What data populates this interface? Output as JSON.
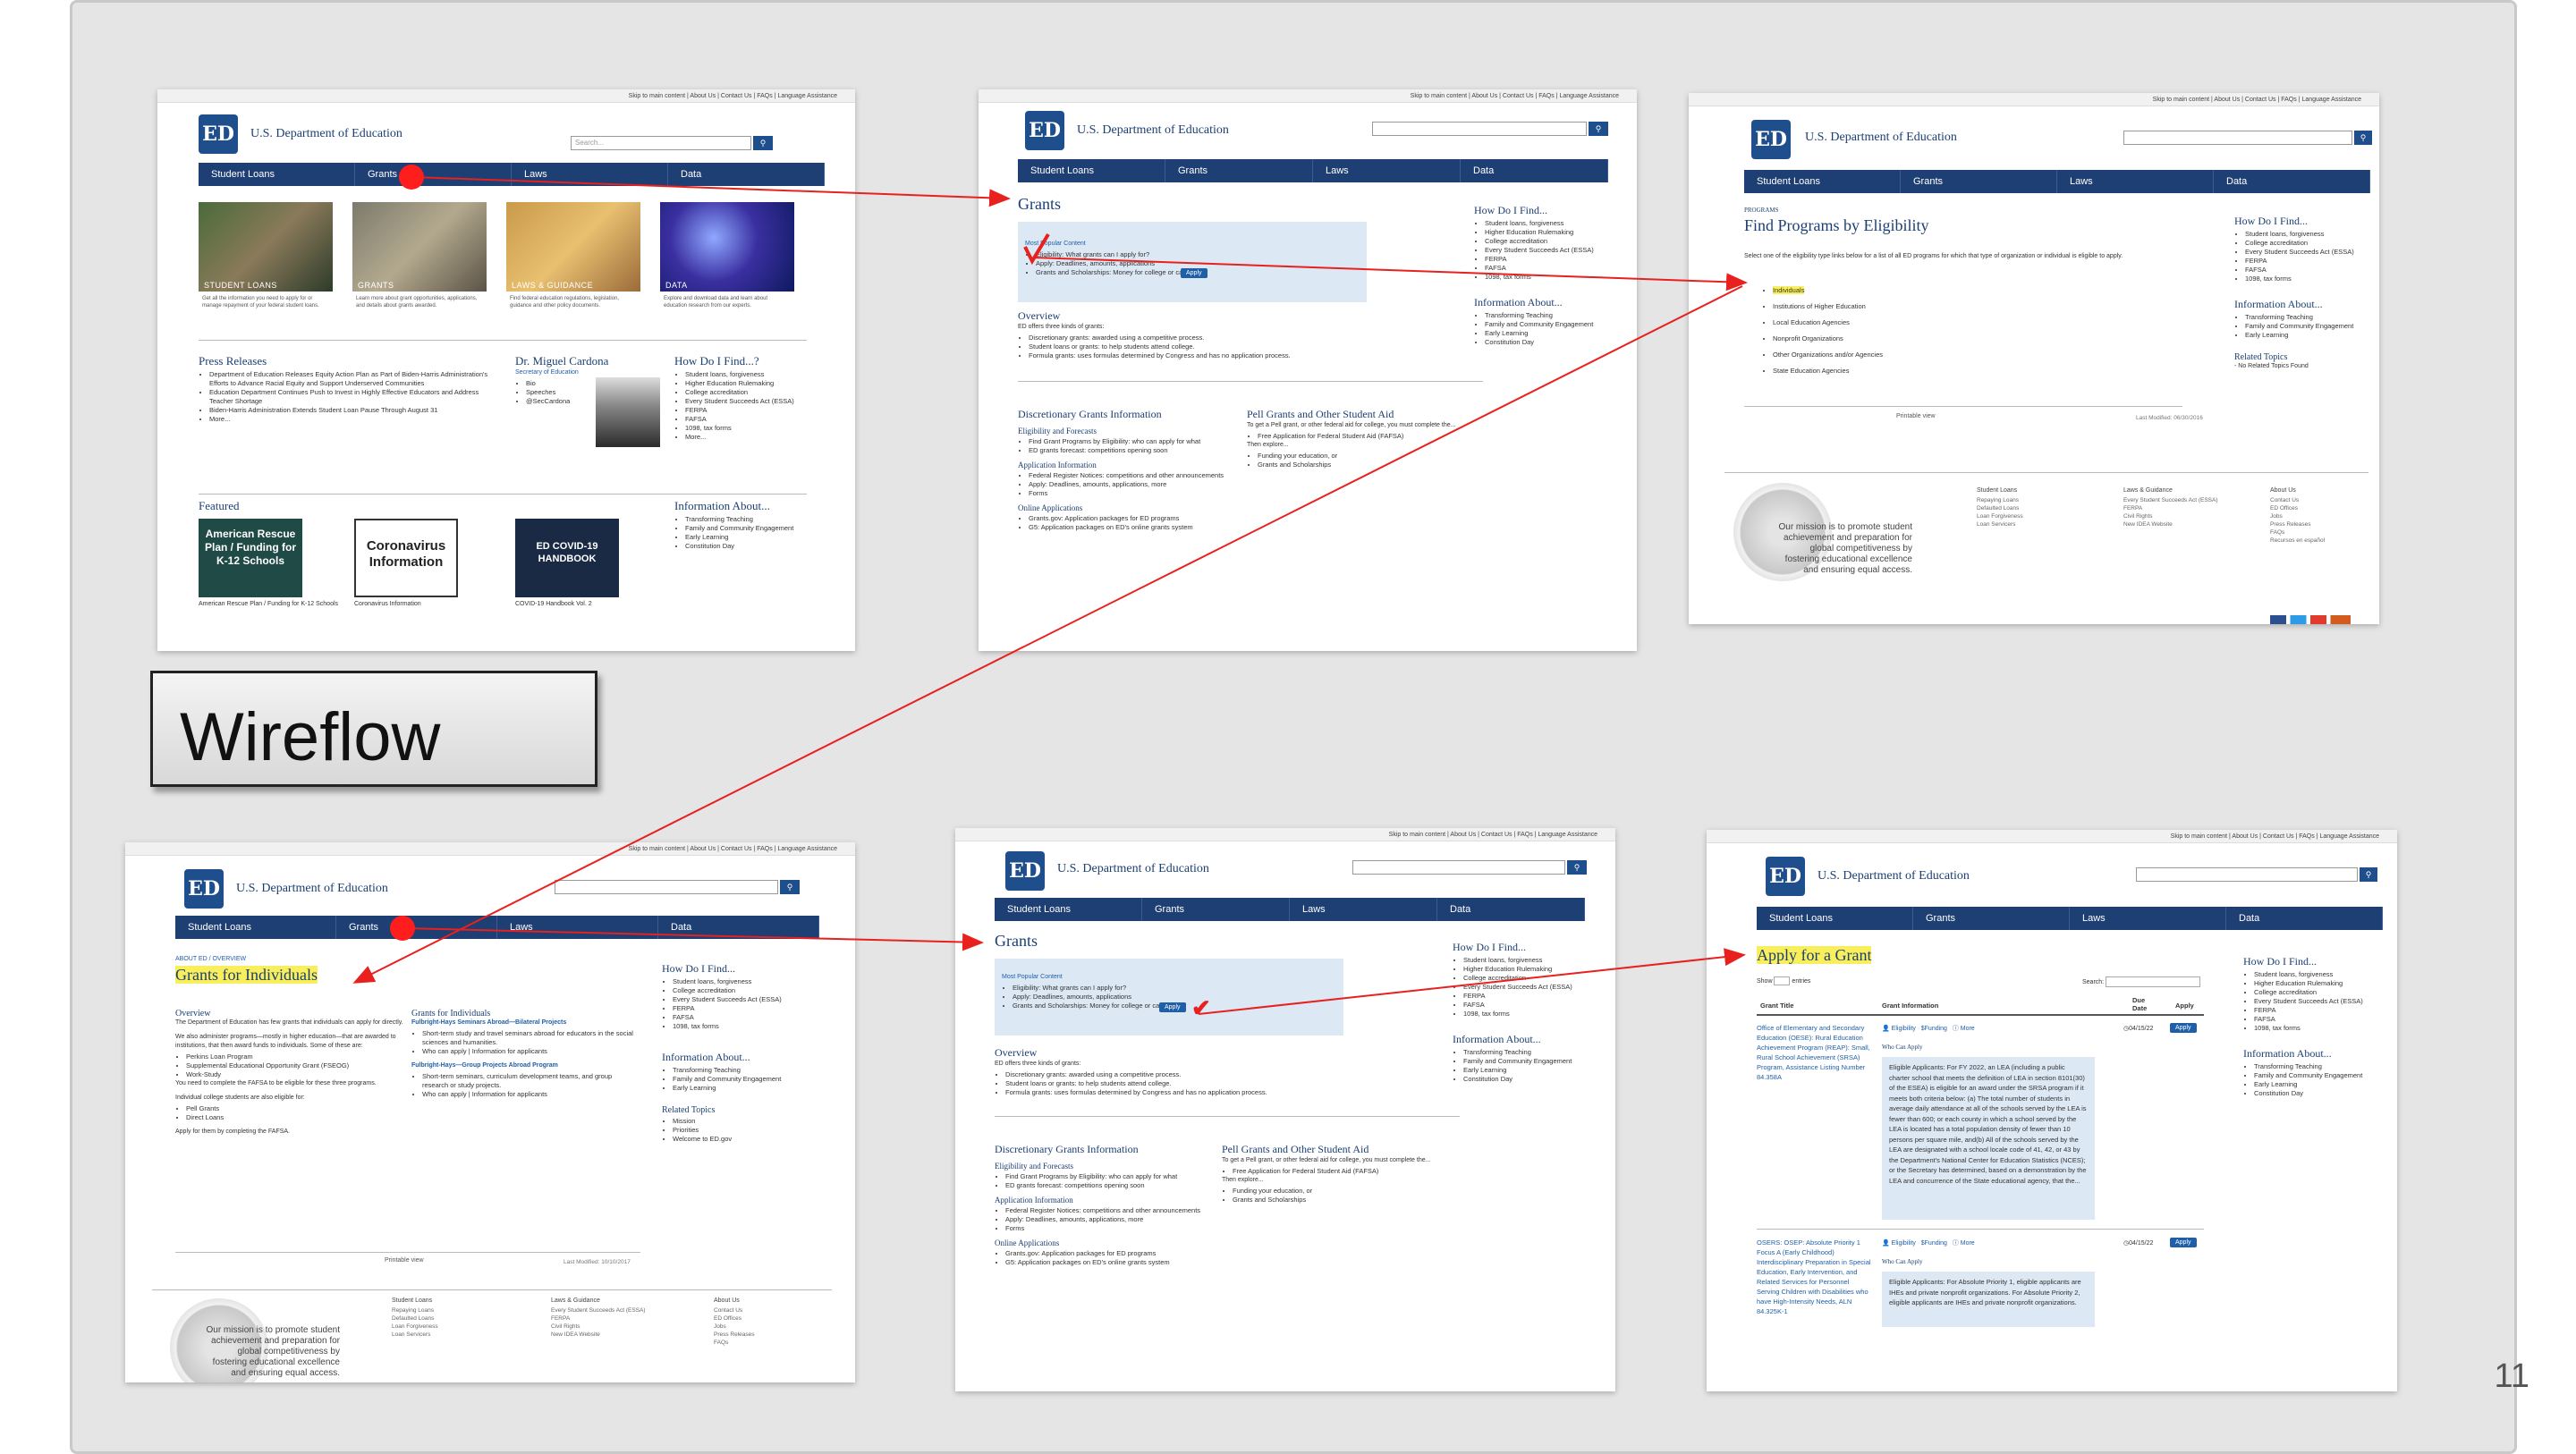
{
  "slide": {
    "title": "Wireflow",
    "page_number": "11"
  },
  "site": {
    "name": "U.S. Department of Education",
    "logo_text": "ED",
    "search_placeholder": "Search...",
    "utility": "Skip to main content | About Us | Contact Us | FAQs | Language Assistance",
    "nav": [
      "Student Loans",
      "Grants",
      "Laws",
      "Data"
    ]
  },
  "home": {
    "tiles": [
      {
        "title": "STUDENT LOANS",
        "text": "Get all the information you need to apply for or manage repayment of your federal student loans."
      },
      {
        "title": "GRANTS",
        "text": "Learn more about grant opportunities, applications, and details about grants awarded."
      },
      {
        "title": "LAWS & GUIDANCE",
        "text": "Find federal education regulations, legislation, guidance and other policy documents."
      },
      {
        "title": "DATA",
        "text": "Explore and download data and learn about education research from our experts."
      }
    ],
    "press_title": "Press Releases",
    "press_items": [
      "Department of Education Releases Equity Action Plan as Part of Biden-Harris Administration's Efforts to Advance Racial Equity and Support Underserved Communities",
      "Education Department Continues Push to Invest in Highly Effective Educators and Address Teacher Shortage",
      "Biden-Harris Administration Extends Student Loan Pause Through August 31",
      "More..."
    ],
    "secretary_name": "Dr. Miguel Cardona",
    "secretary_title": "Secretary of Education",
    "secretary_links": [
      "Bio",
      "Speeches",
      "@SecCardona"
    ],
    "howdo_title": "How Do I Find...?",
    "howdo_items": [
      "Student loans, forgiveness",
      "Higher Education Rulemaking",
      "College accreditation",
      "Every Student Succeeds Act (ESSA)",
      "FERPA",
      "FAFSA",
      "1098, tax forms",
      "More..."
    ],
    "featured_title": "Featured",
    "featured": [
      {
        "text": "American Rescue Plan / Funding for K-12 Schools",
        "caption": "American Rescue Plan / Funding for K-12 Schools"
      },
      {
        "text": "Coronavirus Information",
        "caption": "Coronavirus Information"
      },
      {
        "text": "ED COVID-19 HANDBOOK",
        "caption": "COVID-19 Handbook Vol. 2"
      }
    ],
    "info_title": "Information About...",
    "info_items": [
      "Transforming Teaching",
      "Family and Community Engagement",
      "Early Learning",
      "Constitution Day"
    ]
  },
  "grants": {
    "heading": "Grants",
    "popular_title": "Most Popular Content",
    "popular_items": [
      "Eligibility: What grants can I apply for?",
      "Apply: Deadlines, amounts, applications",
      "Grants and Scholarships: Money for college or career"
    ],
    "apply_label": "Apply",
    "overview_title": "Overview",
    "overview_intro": "ED offers three kinds of grants:",
    "overview_items": [
      "Discretionary grants: awarded using a competitive process.",
      "Student loans or grants: to help students attend college.",
      "Formula grants: uses formulas determined by Congress and has no application process."
    ],
    "disc_title": "Discretionary Grants Information",
    "elig_title": "Eligibility and Forecasts",
    "elig_items": [
      "Find Grant Programs by Eligibility: who can apply for what",
      "ED grants forecast: competitions opening soon"
    ],
    "appinfo_title": "Application Information",
    "appinfo_items": [
      "Federal Register Notices: competitions and other announcements",
      "Apply: Deadlines, amounts, applications, more",
      "Forms"
    ],
    "online_title": "Online Applications",
    "online_items": [
      "Grants.gov: Application packages for ED programs",
      "G5: Application packages on ED's online grants system"
    ],
    "pell_title": "Pell Grants and Other Student Aid",
    "pell_text": "To get a Pell grant, or other federal aid for college, you must complete the...",
    "pell_items": [
      "Free Application for Federal Student Aid (FAFSA)"
    ],
    "explore": "Then explore...",
    "explore_items": [
      "Funding your education, or",
      "Grants and Scholarships"
    ],
    "howdo_title": "How Do I Find...",
    "info_title": "Information About..."
  },
  "eligibility": {
    "kicker": "PROGRAMS",
    "heading": "Find Programs by Eligibility",
    "intro": "Select one of the eligibility type links below for a list of all ED programs for which that type of organization or individual is eligible to apply.",
    "items": [
      "Individuals",
      "Institutions of Higher Education",
      "Local Education Agencies",
      "Nonprofit Organizations",
      "Other Organizations and/or Agencies",
      "State Education Agencies"
    ],
    "printable": "Printable view",
    "last_modified": "Last Modified: 06/30/2016",
    "related_title": "Related Topics",
    "related_text": "- No Related Topics Found",
    "mission": "Our mission is to promote student achievement and preparation for global competitiveness by fostering educational excellence and ensuring equal access.",
    "footer_cols": [
      {
        "title": "Student Loans",
        "items": [
          "Repaying Loans",
          "Defaulted Loans",
          "Loan Forgiveness",
          "Loan Servicers"
        ]
      },
      {
        "title": "Laws & Guidance",
        "items": [
          "Every Student Succeeds Act (ESSA)",
          "FERPA",
          "Civil Rights",
          "New IDEA Website"
        ]
      },
      {
        "title": "About Us",
        "items": [
          "Contact Us",
          "ED Offices",
          "Jobs",
          "Press Releases",
          "FAQs",
          "Recursos en español"
        ]
      }
    ]
  },
  "individuals": {
    "breadcrumb": "ABOUT ED / OVERVIEW",
    "heading": "Grants for Individuals",
    "overview_title": "Overview",
    "overview_text": "The Department of Education has few grants that individuals can apply for directly.",
    "overview_text2": "We also administer programs—mostly in higher education—that are awarded to institutions, that then award funds to individuals. Some of these are:",
    "overview_items": [
      "Perkins Loan Program",
      "Supplemental Educational Opportunity Grant (FSEOG)",
      "Work-Study"
    ],
    "fafsa_text": "You need to complete the FAFSA to be eligible for these three programs.",
    "also_text": "Individual college students are also eligible for:",
    "also_items": [
      "Pell Grants",
      "Direct Loans"
    ],
    "apply_text": "Apply for them by completing the FAFSA.",
    "right_title": "Grants for Individuals",
    "prog1_title": "Fulbright-Hays Seminars Abroad—Bilateral Projects",
    "prog1_items": [
      "Short-term study and travel seminars abroad for educators in the social sciences and humanities.",
      "Who can apply | Information for applicants"
    ],
    "prog2_title": "Fulbright-Hays—Group Projects Abroad Program",
    "prog2_items": [
      "Short-term seminars, curriculum development teams, and group research or study projects.",
      "Who can apply | Information for applicants"
    ],
    "related_items": [
      "Mission",
      "Priorities",
      "Welcome to ED.gov"
    ],
    "last_modified": "Last Modified: 10/10/2017"
  },
  "apply": {
    "heading": "Apply for a Grant",
    "show": "Show",
    "entries": "entries",
    "search": "Search:",
    "columns": [
      "Grant Title",
      "Grant Information",
      "Due Date",
      "Apply"
    ],
    "rows": [
      {
        "title": "Office of Elementary and Secondary Education (OESE): Rural Education Achievement Program (REAP): Small, Rural School Achievement (SRSA) Program, Assistance Listing Number 84.358A",
        "due": "04/15/22",
        "links": [
          "Eligibility",
          "Funding",
          "More"
        ],
        "who": "Who Can Apply",
        "elig": "Eligible Applicants: For FY 2022, an LEA (including a public charter school that meets the definition of LEA in section 8101(30) of the ESEA) is eligible for an award under the SRSA program if it meets both criteria below: (a) The total number of students in average daily attendance at all of the schools served by the LEA is fewer than 600; or each county in which a school served by the LEA is located has a total population density of fewer than 10 persons per square mile, and(b) All of the schools served by the LEA are designated with a school locale code of 41, 42, or 43 by the Department's National Center for Education Statistics (NCES); or the Secretary has determined, based on a demonstration by the LEA and concurrence of the State educational agency, that the..."
      },
      {
        "title": "OSERS: OSEP: Absolute Priority 1 Focus A (Early Childhood) Interdisciplinary Preparation in Special Education, Early Intervention, and Related Services for Personnel Serving Children with Disabilities who have High-Intensity Needs, ALN 84.325K-1",
        "due": "04/15/22",
        "links": [
          "Eligibility",
          "Funding",
          "More"
        ],
        "who": "Who Can Apply",
        "elig": "Eligible Applicants: For Absolute Priority 1, eligible applicants are IHEs and private nonprofit organizations. For Absolute Priority 2, eligible applicants are IHEs and private nonprofit organizations."
      }
    ]
  },
  "colors": {
    "navy": "#1e3f73",
    "red": "#e8201e",
    "highlight": "#f9ef5c",
    "light_blue": "#dce8f4"
  }
}
